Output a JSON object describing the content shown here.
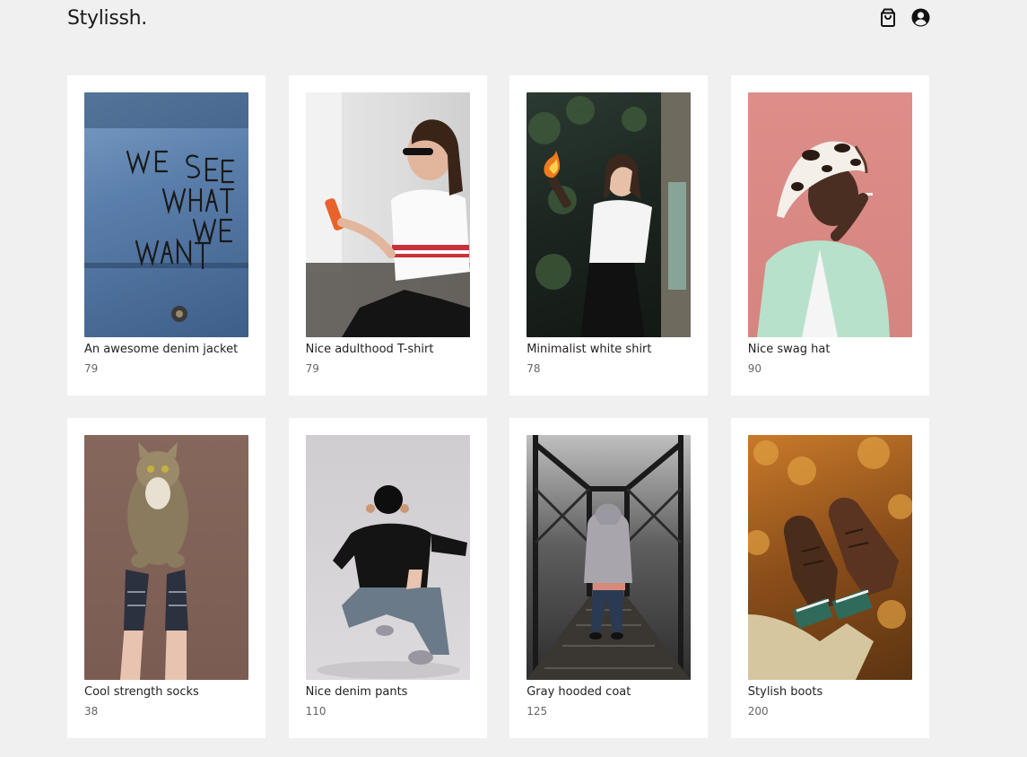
{
  "header": {
    "brand": "Stylissh.",
    "icons": [
      "shopping-bag-icon",
      "user-circle-icon"
    ]
  },
  "products": [
    {
      "title": "An awesome denim jacket",
      "price": "79",
      "image": "denim jacket with 'WE SEE WHAT WE WANT' handwriting"
    },
    {
      "title": "Nice adulthood T-shirt",
      "price": "79",
      "image": "woman in sunglasses holding orange phone"
    },
    {
      "title": "Minimalist white shirt",
      "price": "78",
      "image": "woman in white shirt holding burning bottle in woods"
    },
    {
      "title": "Nice swag hat",
      "price": "90",
      "image": "man in cow-print hat smoking against pink wall"
    },
    {
      "title": "Cool strength socks",
      "price": "38",
      "image": "cat standing on legs wearing socks"
    },
    {
      "title": "Nice denim pants",
      "price": "110",
      "image": "man crouching in ripped denim pants"
    },
    {
      "title": "Gray hooded coat",
      "price": "125",
      "image": "person in gray hoodie on railway bridge"
    },
    {
      "title": "Stylish boots",
      "price": "200",
      "image": "brown boots with striped socks and autumn leaves"
    }
  ],
  "colors": {
    "background": "#f0f0f0",
    "card": "#ffffff",
    "text": "#222222",
    "price": "#666666"
  }
}
